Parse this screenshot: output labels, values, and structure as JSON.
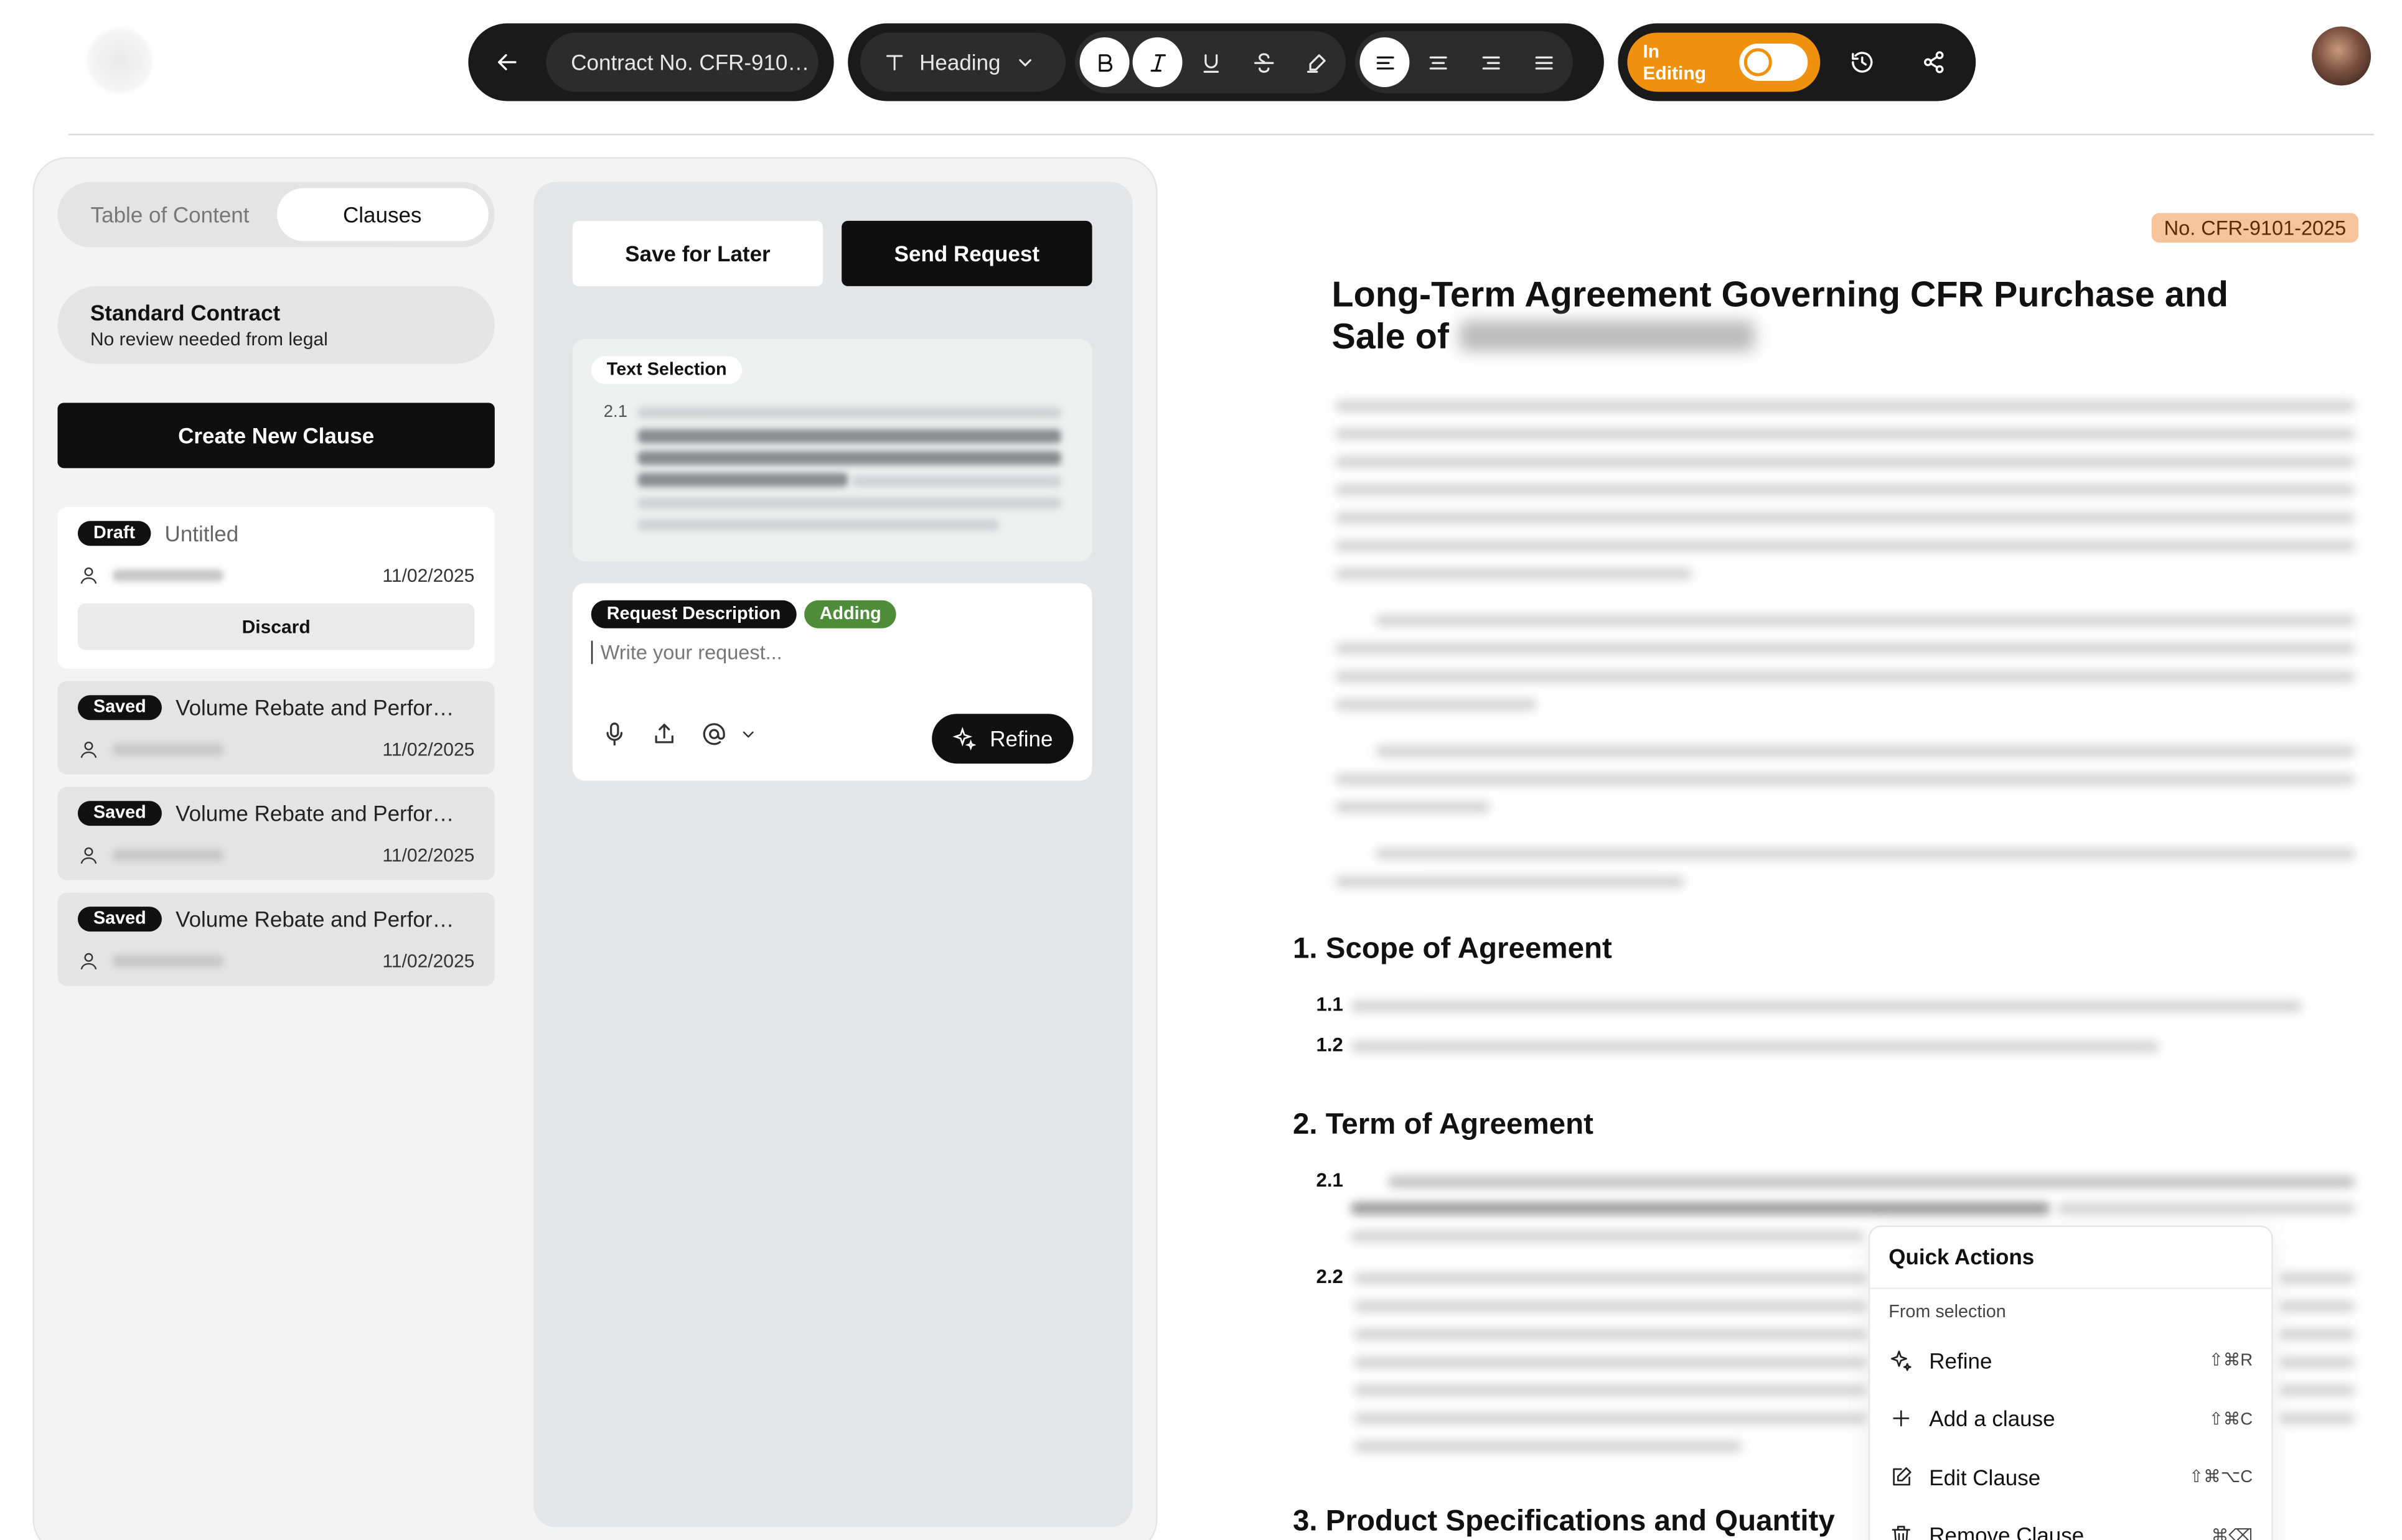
{
  "toolbar": {
    "doc_title": "Contract No. CFR-910…",
    "heading_style": "Heading",
    "editing_label": "In Editing",
    "accent": "#f0900f"
  },
  "sidebar": {
    "tabs": [
      "Table of Content",
      "Clauses"
    ],
    "active_tab": "Clauses",
    "standard": {
      "title": "Standard Contract",
      "subtitle": "No review needed from legal"
    },
    "create_label": "Create New Clause",
    "draft": {
      "badge": "Draft",
      "title": "Untitled",
      "date": "11/02/2025",
      "discard_label": "Discard"
    },
    "saved": [
      {
        "badge": "Saved",
        "title": "Volume Rebate and Perfor…",
        "date": "11/02/2025"
      },
      {
        "badge": "Saved",
        "title": "Volume Rebate and Perfor…",
        "date": "11/02/2025"
      },
      {
        "badge": "Saved",
        "title": "Volume Rebate and Perfor…",
        "date": "11/02/2025"
      }
    ]
  },
  "request": {
    "save_label": "Save for Later",
    "send_label": "Send Request",
    "selection_chip": "Text Selection",
    "selection_num": "2.1",
    "desc_chip": "Request Description",
    "status_chip": "Adding",
    "placeholder": "Write your request...",
    "refine_label": "Refine"
  },
  "document": {
    "number": "No. CFR-9101-2025",
    "title": "Long-Term Agreement Governing CFR Purchase and Sale of",
    "sections": [
      {
        "title": "1. Scope of Agreement",
        "items": [
          "1.1",
          "1.2"
        ]
      },
      {
        "title": "2. Term of Agreement",
        "items": [
          "2.1",
          "2.2"
        ]
      },
      {
        "title": "3. Product Specifications and Quantity",
        "items": []
      }
    ]
  },
  "quick_actions": {
    "title": "Quick Actions",
    "subtitle": "From selection",
    "items": [
      {
        "label": "Refine",
        "shortcut": "⇧⌘R",
        "icon": "sparkle-icon"
      },
      {
        "label": "Add a clause",
        "shortcut": "⇧⌘C",
        "icon": "plus-icon"
      },
      {
        "label": "Edit Clause",
        "shortcut": "⇧⌘⌥C",
        "icon": "edit-icon"
      },
      {
        "label": "Remove Clause",
        "shortcut": "⌘⌫",
        "icon": "trash-icon"
      }
    ]
  }
}
